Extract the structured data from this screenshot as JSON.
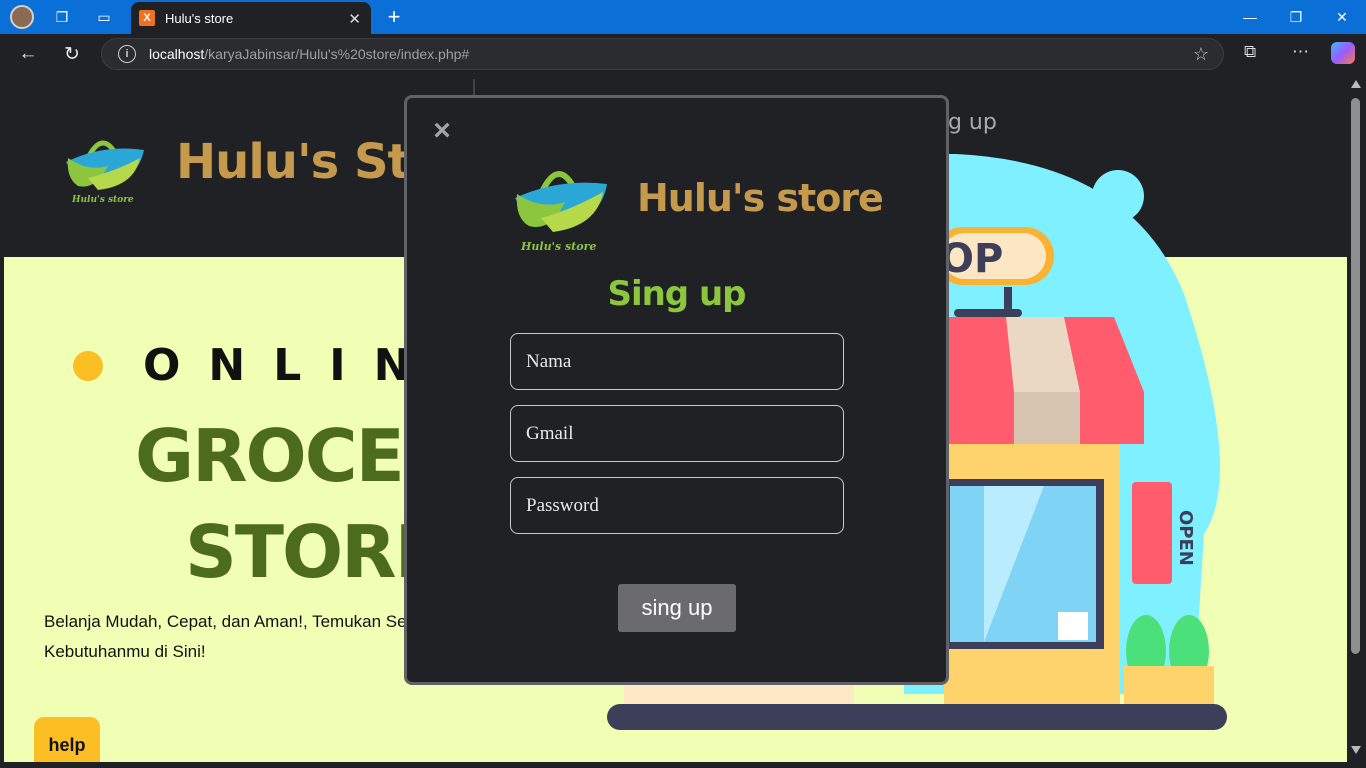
{
  "browser": {
    "tab_title": "Hulu's store",
    "tab_favicon": "X",
    "url_host": "localhost",
    "url_path": "/karyaJabinsar/Hulu's%20store/index.php#",
    "accent": "#0a6fd6"
  },
  "header": {
    "brand": "Hulu's Store",
    "logo_caption": "Hulu's store",
    "nav_partial": "ng up"
  },
  "hero": {
    "kicker": "ONLINE",
    "title_line1": "GROCERY",
    "title_line2": "STORE",
    "description": "Belanja Mudah, Cepat, dan Aman!, Temukan Se Kebutuhanmu di Sini!",
    "sign_text": "OP",
    "open_sign": "OPEN"
  },
  "help_button": {
    "label": "help"
  },
  "modal": {
    "close_icon": "×",
    "brand": "Hulu's store",
    "logo_caption": "Hulu's store",
    "title": "Sing up",
    "fields": {
      "name_placeholder": "Nama",
      "gmail_placeholder": "Gmail",
      "password_placeholder": "Password"
    },
    "submit_label": "sing up"
  },
  "colors": {
    "page_bg": "#f1ffb5",
    "header_bg": "#202124",
    "brand": "#c69a4d",
    "title_green": "#8cc63f",
    "hero_green": "#4d6b1c",
    "dot": "#fbbf24"
  }
}
